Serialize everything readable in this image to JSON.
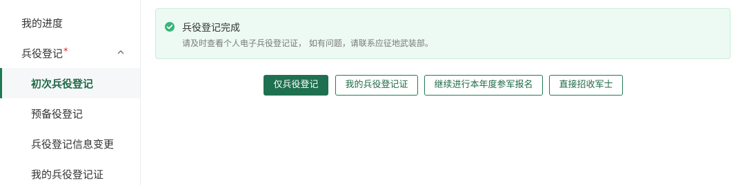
{
  "sidebar": {
    "progress": "我的进度",
    "group": {
      "label": "兵役登记",
      "required_mark": "*",
      "expanded": true,
      "chevron_icon": "chevron-up-icon"
    },
    "items": [
      {
        "label": "初次兵役登记",
        "active": true
      },
      {
        "label": "预备役登记",
        "active": false
      },
      {
        "label": "兵役登记信息变更",
        "active": false
      },
      {
        "label": "我的兵役登记证",
        "active": false
      }
    ]
  },
  "notice": {
    "icon": "check-circle-icon",
    "title": "兵役登记完成",
    "description": "请及时查看个人电子兵役登记证， 如有问题，请联系应征地武装部。"
  },
  "actions": {
    "register_only": "仅兵役登记",
    "my_certificate": "我的兵役登记证",
    "continue_enlist": "继续进行本年度参军报名",
    "direct_recruit": "直接招收军士"
  },
  "colors": {
    "accent": "#1f7050",
    "notice_bg": "#ecfaf3",
    "notice_border": "#c9ecd9",
    "success_icon": "#3bb47a",
    "required_star": "#e02020"
  }
}
